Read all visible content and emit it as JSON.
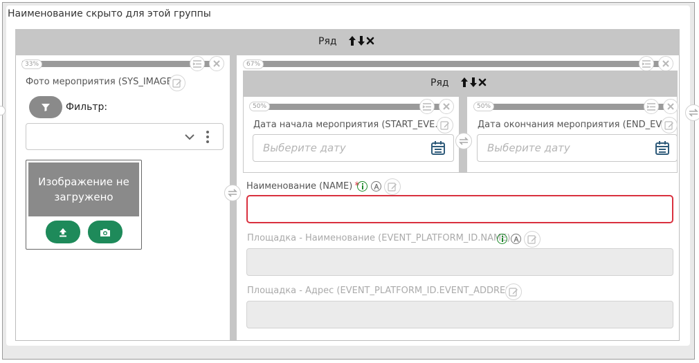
{
  "group": {
    "title": "Наименование скрыто для этой группы"
  },
  "outer_row": {
    "title": "Ряд",
    "arrows": "🠕🠗✖"
  },
  "col_left": {
    "percent": "33%",
    "field_label": "Фото мероприятия (SYS_IMAGE)",
    "filter_label": "Фильтр:",
    "image_placeholder": "Изображение не загружено"
  },
  "col_right": {
    "percent": "67%",
    "inner_row": {
      "title": "Ряд"
    },
    "date_start": {
      "percent": "50%",
      "label": "Дата начала мероприятия (START_EVE...",
      "placeholder": "Выберите дату"
    },
    "date_end": {
      "percent": "50%",
      "label": "Дата окончания мероприятия (END_EV...",
      "placeholder": "Выберите дату"
    },
    "name": {
      "label": "Наименование (NAME)",
      "required": "*"
    },
    "platform_name": {
      "label": "Площадка - Наименование (EVENT_PLATFORM_ID.NAME)"
    },
    "platform_address": {
      "label": "Площадка - Адрес (EVENT_PLATFORM_ID.EVENT_ADDRESS)"
    }
  },
  "colors": {
    "accent_green": "#1e8a5a",
    "error_red": "#d9303e",
    "info_green": "#1e8a2a"
  }
}
